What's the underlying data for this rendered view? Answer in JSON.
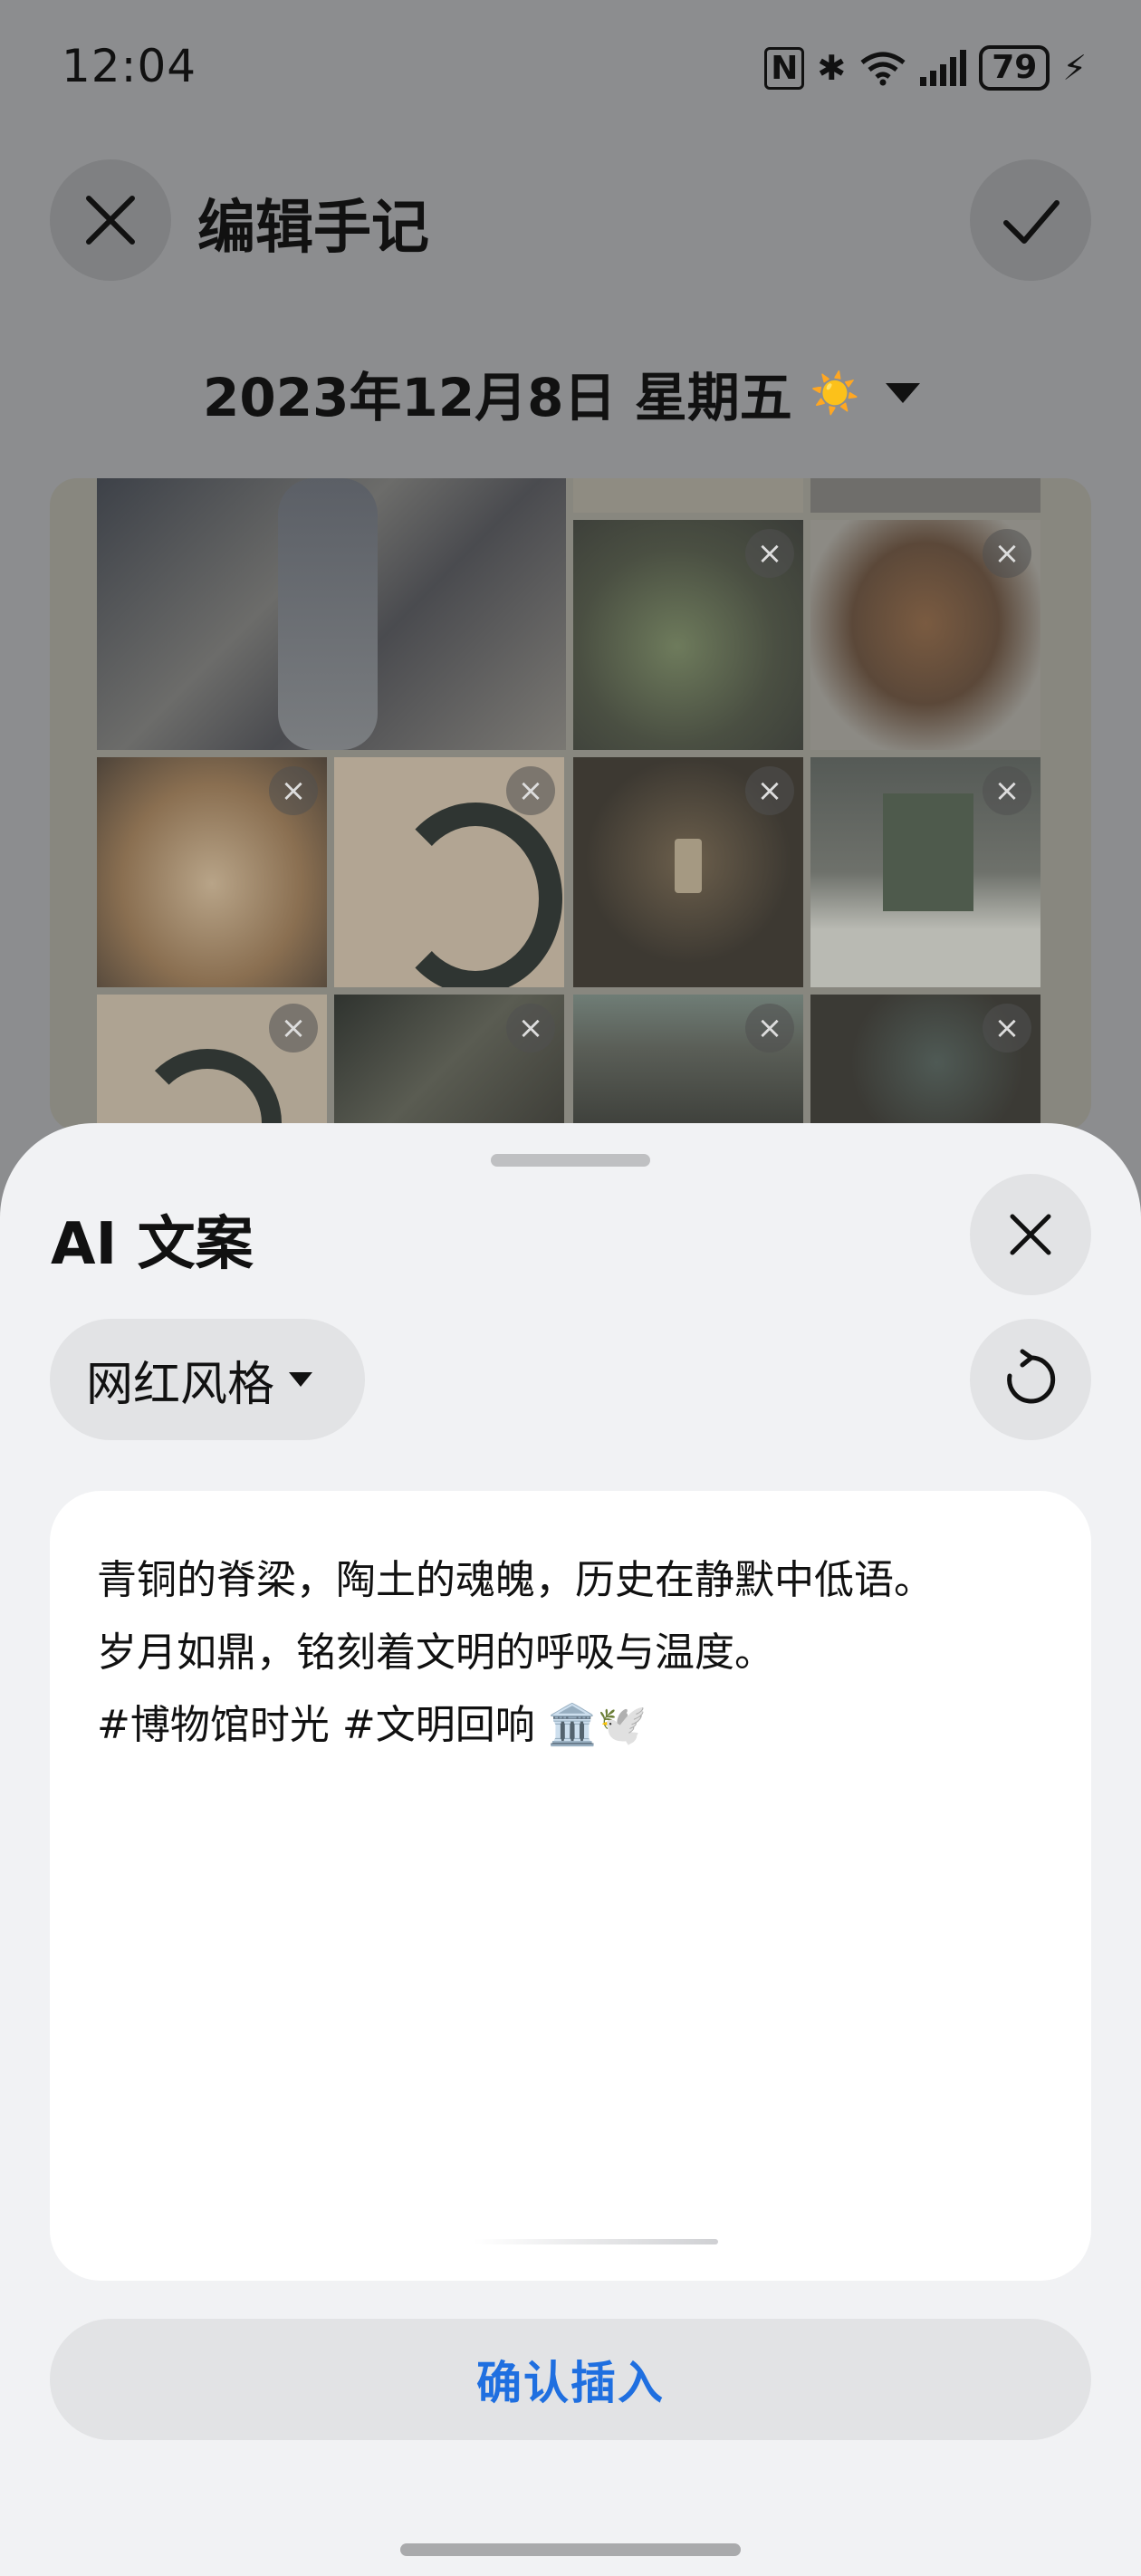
{
  "status_bar": {
    "time": "12:04",
    "battery": "79",
    "icons": [
      "nfc-icon",
      "bluetooth-icon",
      "wifi-6-icon",
      "cellular-signal-icon",
      "battery-icon",
      "charging-icon"
    ]
  },
  "header": {
    "title": "编辑手记",
    "close_icon": "close-icon",
    "confirm_icon": "check-icon"
  },
  "date_row": {
    "date": "2023年12月8日 星期五",
    "weather_icon": "☀️",
    "dropdown_icon": "triangle-down-icon"
  },
  "photos": {
    "count_visible": 15,
    "remove_icon": "remove-photo-icon",
    "remove_glyph": "×"
  },
  "sheet": {
    "title": "AI 文案",
    "close_icon": "close-icon",
    "style_selector": "网红风格",
    "refresh_icon": "refresh-icon",
    "text_lines": [
      "青铜的脊梁，陶土的魂魄，历史在静默中低语。",
      "岁月如鼎，铭刻着文明的呼吸与温度。",
      "#博物馆时光 #文明回响 🏛️🕊️"
    ],
    "confirm_button": "确认插入"
  },
  "colors": {
    "accent": "#1f6fe0",
    "sheet_bg": "#f1f2f4",
    "scrim": "#8c8d8f"
  }
}
